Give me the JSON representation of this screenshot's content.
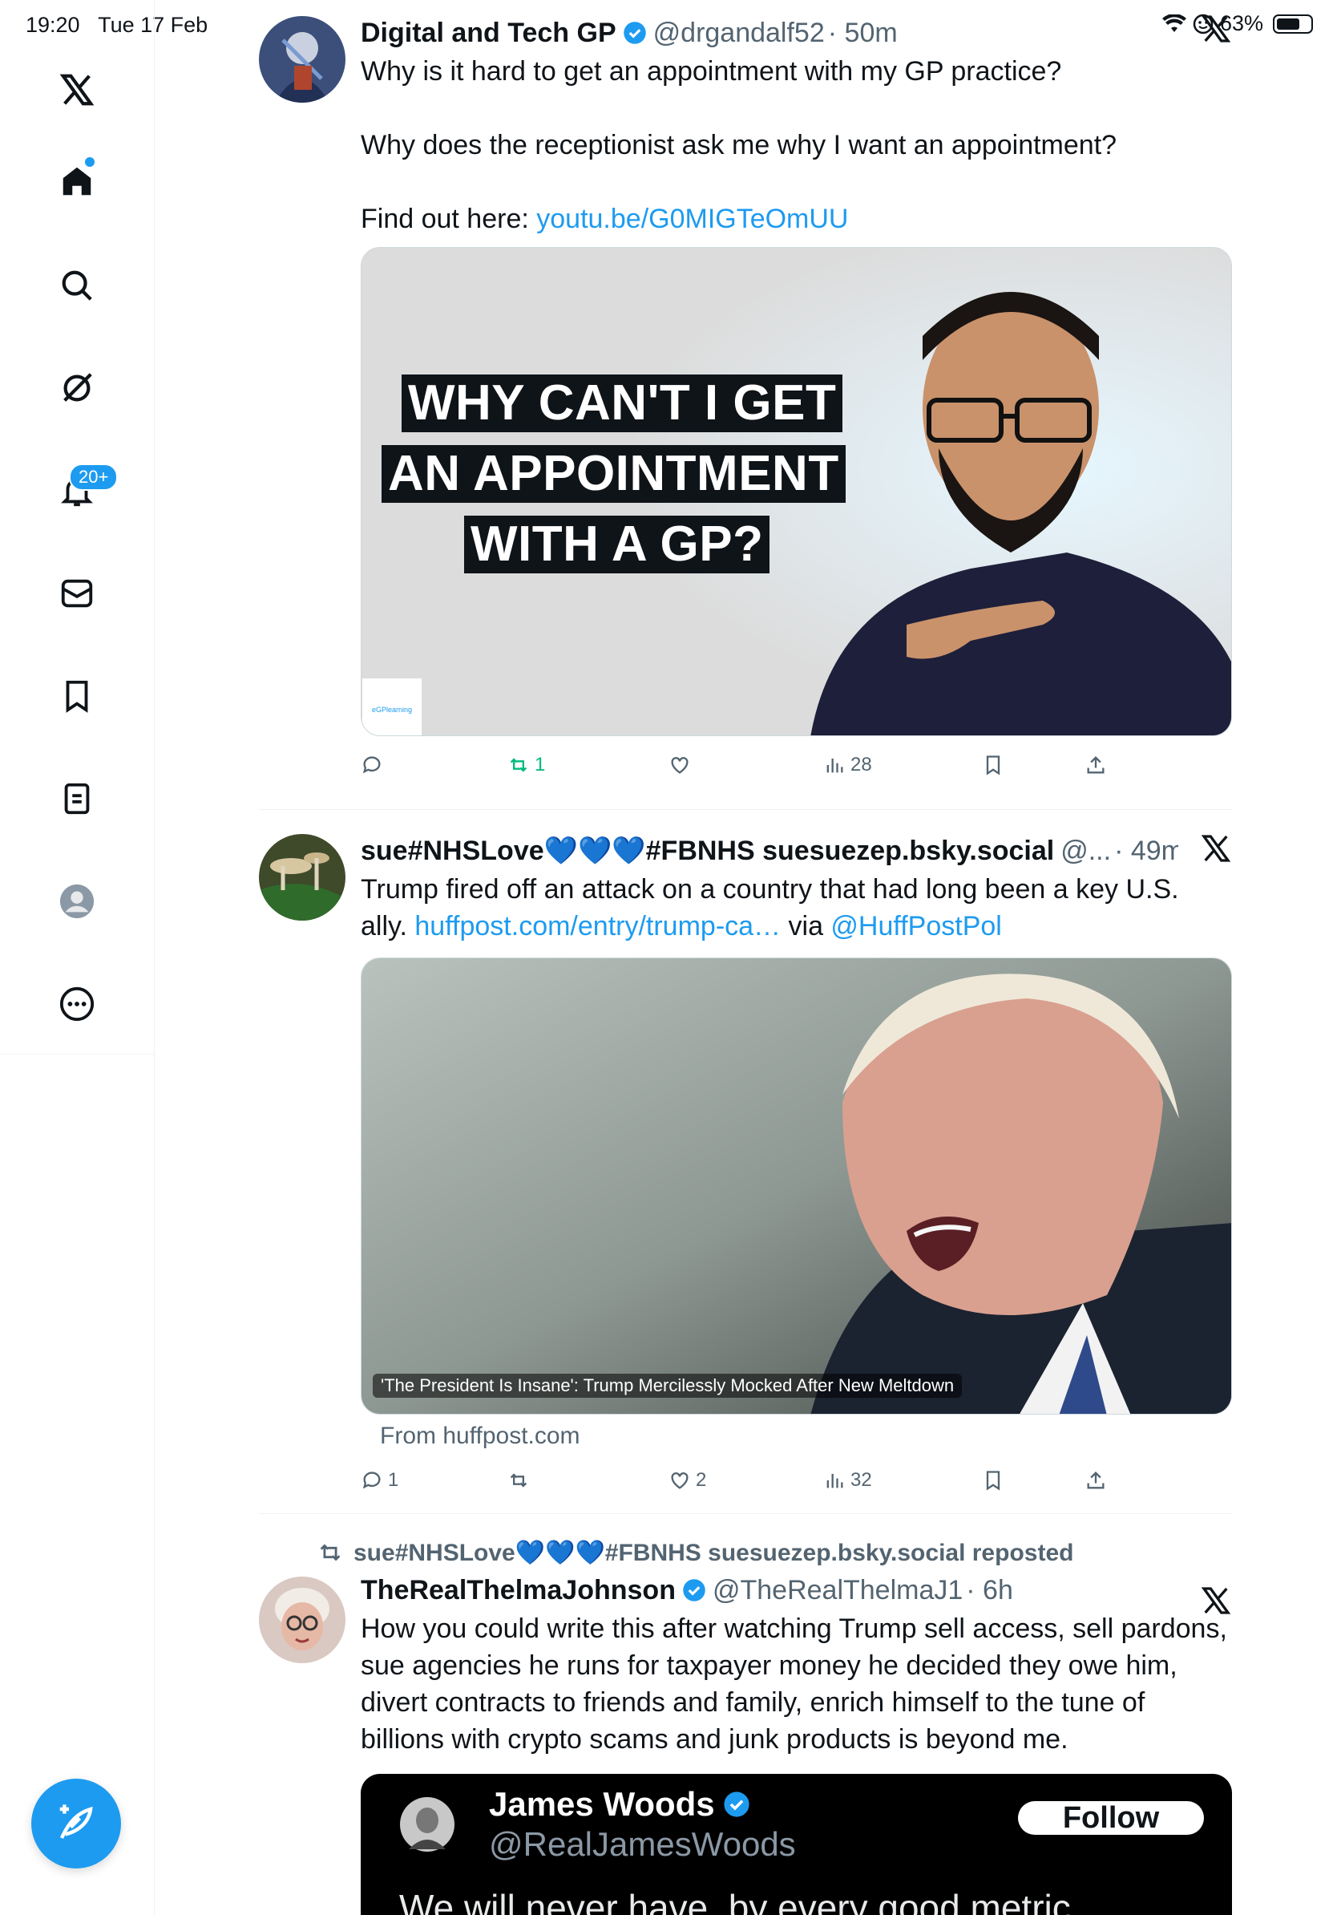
{
  "status": {
    "time": "19:20",
    "date": "Tue 17 Feb",
    "battery": "63%"
  },
  "sidebar": {
    "notifications_badge": "20+",
    "items": [
      "x-logo",
      "home",
      "search",
      "grok",
      "notifications",
      "messages",
      "bookmarks",
      "lists",
      "profile",
      "more"
    ]
  },
  "tweets": [
    {
      "display_name": "Digital and Tech GP",
      "verified": true,
      "handle": "@drgandalf52",
      "time": "· 50m",
      "text_line1": "Why is it hard to get an appointment with my GP practice?",
      "text_line2": "Why does the receptionist ask me why I want an appointment?",
      "text_line3_prefix": "Find out here: ",
      "text_link": "youtu.be/G0MIGTeOmUU",
      "thumb_lines": [
        "WHY CAN'T I GET",
        "AN APPOINTMENT",
        "WITH A GP?"
      ],
      "thumb_logo": "eGPlearning",
      "stats": {
        "replies": "",
        "reposts": "1",
        "likes": "",
        "views": "28"
      }
    },
    {
      "display_name": "sue#NHSLove💙💙💙#FBNHS suesuezep.bsky.social",
      "verified": false,
      "handle": "@...",
      "time": "· 49m",
      "text_a": "Trump fired off an attack on a country that had long been a key U.S. ally. ",
      "text_link": "huffpost.com/entry/trump-ca…",
      "text_via": " via ",
      "text_mention": "@HuffPostPol",
      "card_caption": "'The President Is Insane': Trump Mercilessly Mocked After New Meltdown",
      "card_domain": "From huffpost.com",
      "stats": {
        "replies": "1",
        "reposts": "",
        "likes": "2",
        "views": "32"
      }
    },
    {
      "repost_by": "sue#NHSLove💙💙💙#FBNHS suesuezep.bsky.social reposted",
      "display_name": "TheRealThelmaJohnson",
      "verified": true,
      "handle": "@TheRealThelmaJ1",
      "time": "· 6h",
      "text": "How you could write this after watching Trump sell access, sell pardons, sue agencies he runs for taxpayer money he decided they owe him, divert contracts to friends and family, enrich himself to the tune of billions with crypto scams and junk products is beyond me.",
      "quoted": {
        "display_name": "James Woods",
        "handle": "@RealJamesWoods",
        "follow_label": "Follow",
        "text": "We will never have, by every good metric"
      }
    }
  ],
  "colors": {
    "accent": "#1d9bf0",
    "text": "#0f1419",
    "muted": "#536471",
    "repost": "#00ba7c"
  }
}
